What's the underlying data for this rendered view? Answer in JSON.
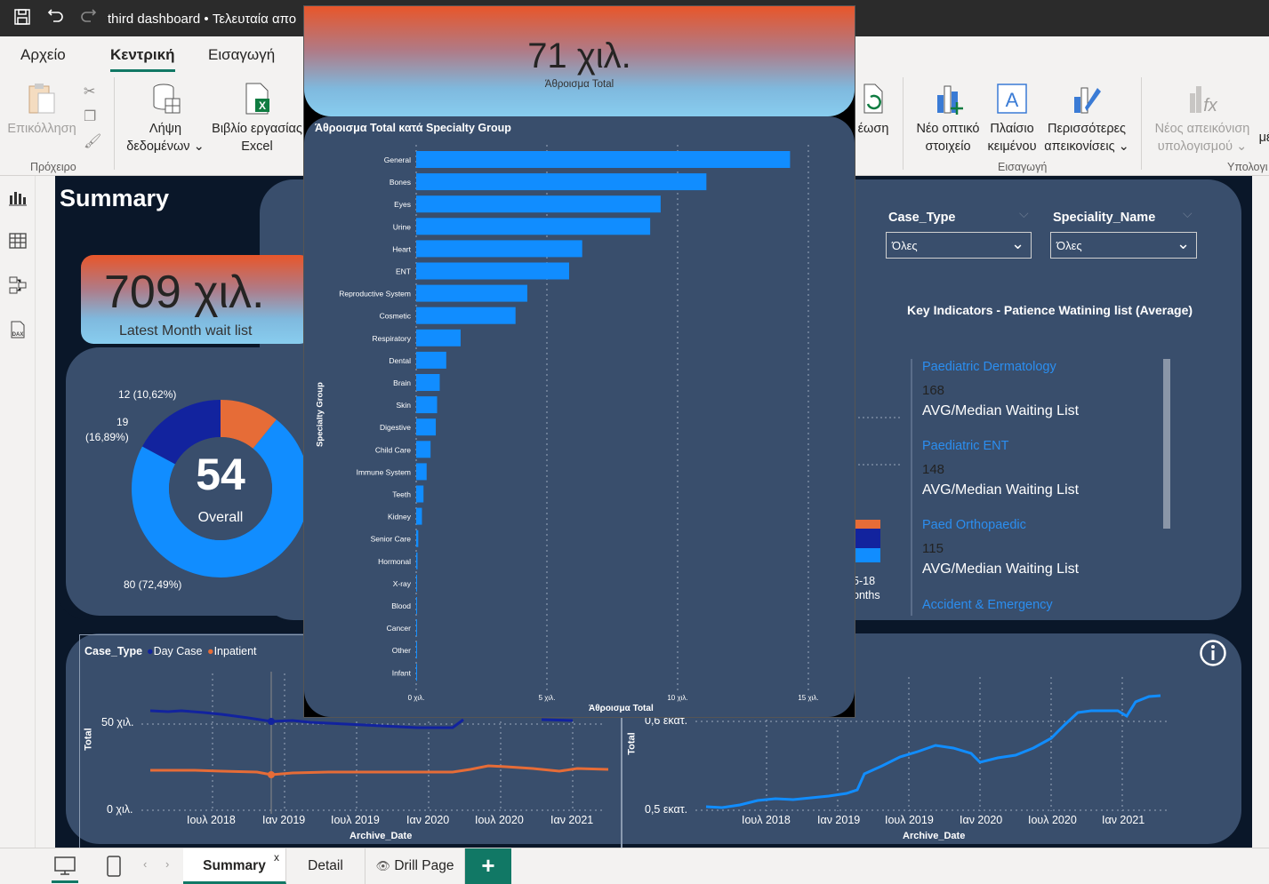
{
  "titlebar": {
    "title": "third dashboard • Τελευταία απο"
  },
  "menu_tabs": [
    "Αρχείο",
    "Κεντρική",
    "Εισαγωγή"
  ],
  "ribbon": {
    "paste": "Επικόλληση",
    "get_data_1": "Λήψη",
    "get_data_2": "δεδομένων",
    "excel_1": "Βιβλίο εργασίας",
    "excel_2": "Excel",
    "refresh": "έωση",
    "new_visual_1": "Νέο οπτικό",
    "new_visual_2": "στοιχείο",
    "textbox_1": "Πλαίσιο",
    "textbox_2": "κειμένου",
    "more_visuals_1": "Περισσότερες",
    "more_visuals_2": "απεικονίσεις",
    "new_measure_1": "Νέος απεικόνιση",
    "new_measure_2": "υπολογισμού",
    "cut_off": "μέ",
    "group_clipboard": "Πρόχειρο",
    "group_insert": "Εισαγωγή",
    "group_calc": "Υπολογι"
  },
  "report": {
    "title": "Summary",
    "kpi_value": "709 χιλ.",
    "kpi_label": "Latest Month wait list",
    "donut_center_value": "54",
    "donut_center_label": "Overall",
    "donut_labels": [
      "12 (10,62%)",
      "19",
      "(16,89%)",
      "80 (72,49%)"
    ],
    "donut_values": [
      80,
      19,
      12
    ],
    "donut_colors": [
      "#118dff",
      "#12239e",
      "#e66c37"
    ],
    "slicer1_label": "Case_Type",
    "slicer1_value": "Όλες",
    "slicer2_label": "Speciality_Name",
    "slicer2_value": "Όλες",
    "key_indicators_title": "Key Indicators - Patience Watining list (Average)",
    "indicators": [
      {
        "name": "Paediatric Dermatology",
        "value": "168",
        "label": "AVG/Median Waiting List"
      },
      {
        "name": "Paediatric ENT",
        "value": "148",
        "label": "AVG/Median Waiting List"
      },
      {
        "name": "Paed Orthopaedic",
        "value": "115",
        "label": "AVG/Median Waiting List"
      },
      {
        "name": "Accident & Emergency",
        "value": "",
        "label": ""
      }
    ],
    "partial_bar_labels": [
      "5-18",
      "onths"
    ],
    "line1": {
      "legend_title": "Case_Type",
      "legend_items": [
        "Day Case",
        "Inpatient"
      ],
      "y_ticks": [
        "50 χιλ.",
        "0 χιλ."
      ],
      "x_ticks": [
        "Ιουλ 2018",
        "Ιαν 2019",
        "Ιουλ 2019",
        "Ιαν 2020",
        "Ιουλ 2020",
        "Ιαν 2021"
      ],
      "ylabel": "Total",
      "xlabel": "Archive_Date"
    },
    "line2": {
      "y_ticks": [
        "0,6 εκατ.",
        "0,5 εκατ."
      ],
      "x_ticks": [
        "Ιουλ 2018",
        "Ιαν 2019",
        "Ιουλ 2019",
        "Ιαν 2020",
        "Ιουλ 2020",
        "Ιαν 2021"
      ],
      "ylabel": "Total",
      "xlabel": "Archive_Date"
    },
    "info_icon": "info-icon"
  },
  "popup": {
    "kpi_value": "71 χιλ.",
    "kpi_label": "Άθροισμα Total",
    "chart_title": "Άθροισμα Total κατά Specialty Group",
    "ylabel": "Specialty Group",
    "xlabel": "Άθροισμα Total",
    "x_ticks": [
      "0 χιλ.",
      "5 χιλ.",
      "10 χιλ.",
      "15 χιλ."
    ]
  },
  "chart_data": {
    "type": "bar",
    "orientation": "horizontal",
    "title": "Άθροισμα Total κατά Specialty Group",
    "xlabel": "Άθροισμα Total",
    "ylabel": "Specialty Group",
    "xlim": [
      0,
      15000
    ],
    "color": "#118dff",
    "categories": [
      "General",
      "Bones",
      "Eyes",
      "Urine",
      "Heart",
      "ENT",
      "Reproductive System",
      "Cosmetic",
      "Respiratory",
      "Dental",
      "Brain",
      "Skin",
      "Digestive",
      "Child Care",
      "Immune System",
      "Teeth",
      "Kidney",
      "Senior Care",
      "Hormonal",
      "X-ray",
      "Blood",
      "Cancer",
      "Other",
      "Infant"
    ],
    "values": [
      14300,
      11100,
      9350,
      8950,
      6350,
      5850,
      4250,
      3800,
      1700,
      1150,
      900,
      800,
      750,
      550,
      400,
      280,
      220,
      80,
      50,
      30,
      20,
      15,
      10,
      5
    ]
  },
  "bottom_tabs": [
    "Summary",
    "Detail",
    "Drill Page"
  ],
  "tab_close": "x",
  "add_tab": "+"
}
